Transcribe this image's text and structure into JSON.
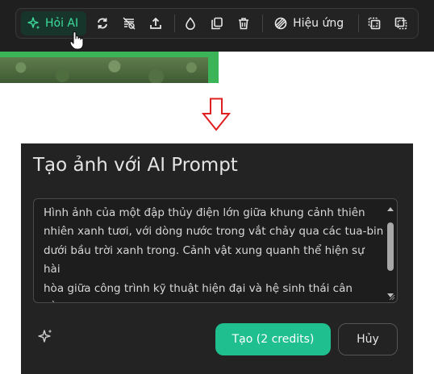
{
  "toolbar": {
    "ai_button_label": "Hỏi AI",
    "effects_label": "Hiệu ứng",
    "icons": [
      "sparkle-icon",
      "replace-icon",
      "remove-background-icon",
      "upload-icon",
      "drop-icon",
      "duplicate-icon",
      "trash-icon",
      "effects-icon",
      "bring-forward-icon",
      "send-backward-icon"
    ]
  },
  "dialog": {
    "title": "Tạo ảnh với AI Prompt",
    "prompt_text": "Hình ảnh của một đập thủy điện lớn giữa khung cảnh thiên\nnhiên xanh tươi, với dòng nước trong vắt chảy qua các tua-bin\ndưới bầu trời xanh trong. Cảnh vật xung quanh thể hiện sự hài\nhòa giữa công trình kỹ thuật hiện đại và hệ sinh thái cân bằng,\nmang lại cảm giác gần gũi với thiên nhiên và sự bền vững của",
    "create_label": "Tạo (2 credits)",
    "cancel_label": "Hủy"
  },
  "colors": {
    "accent": "#1fbf8f",
    "ai_text": "#3ddc9c",
    "arrow": "#e02020",
    "image_border": "#3cb558"
  }
}
